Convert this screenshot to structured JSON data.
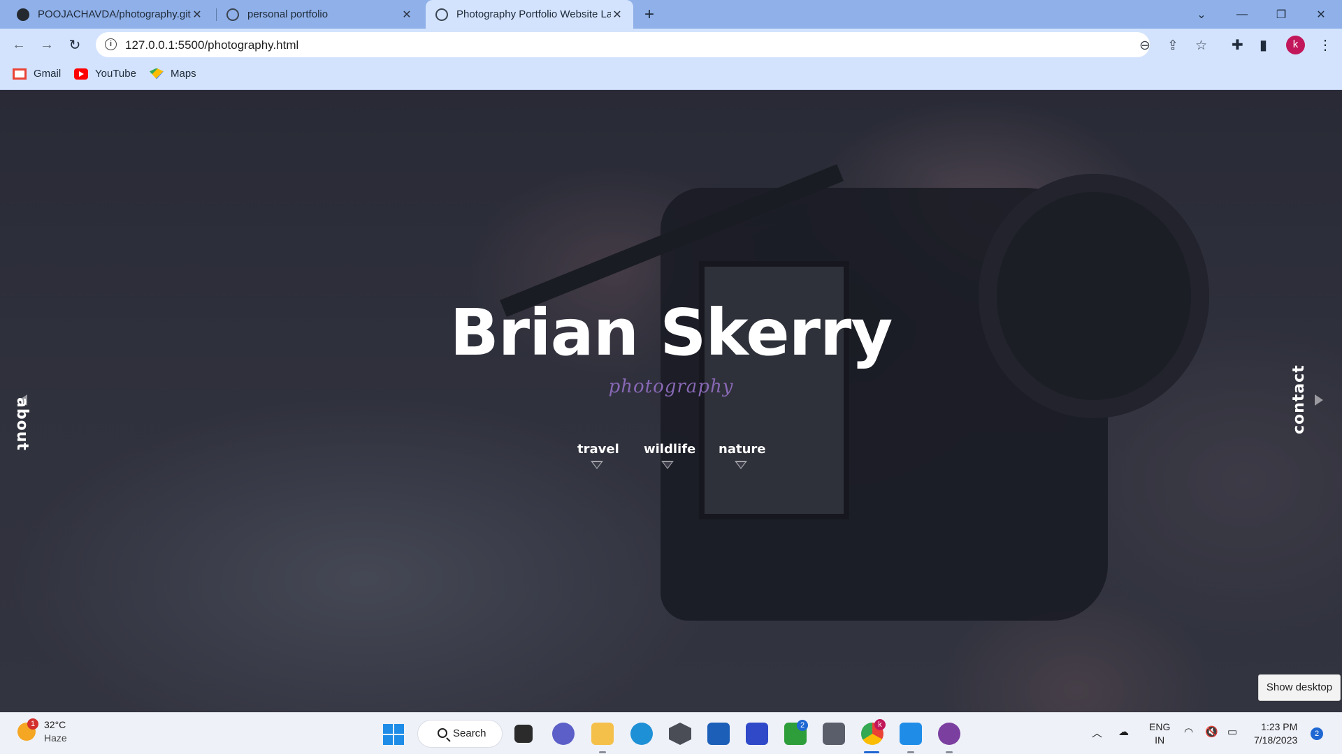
{
  "browser": {
    "tabs": [
      {
        "title": "POOJACHAVDA/photography.git",
        "icon": "github-icon"
      },
      {
        "title": "personal portfolio",
        "icon": "globe-icon"
      },
      {
        "title": "Photography Portfolio Website La",
        "icon": "globe-icon",
        "active": true
      }
    ],
    "address": "127.0.0.1:5500/photography.html",
    "profile_initial": "k",
    "bookmarks": [
      {
        "label": "Gmail",
        "icon": "gmail-icon"
      },
      {
        "label": "YouTube",
        "icon": "youtube-icon"
      },
      {
        "label": "Maps",
        "icon": "maps-icon"
      }
    ]
  },
  "page": {
    "title": "Brian Skerry",
    "subtitle": "photography",
    "side_left": "about",
    "side_right": "contact",
    "categories": [
      "travel",
      "wildlife",
      "nature"
    ],
    "accent_color": "#8868b5"
  },
  "tooltip": "Show desktop",
  "taskbar": {
    "weather_temp": "32°C",
    "weather_desc": "Haze",
    "weather_badge": "1",
    "search_label": "Search",
    "xbox_badge": "2",
    "chrome_badge": "k",
    "lang_primary": "ENG",
    "lang_secondary": "IN",
    "time": "1:23 PM",
    "date": "7/18/2023",
    "notifications": "2"
  }
}
